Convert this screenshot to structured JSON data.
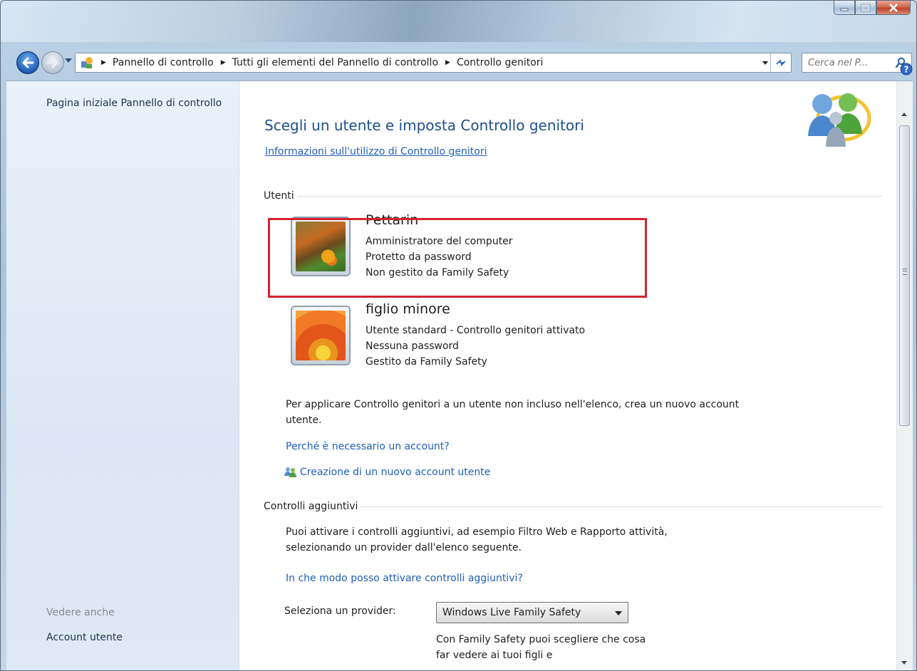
{
  "window": {
    "caption": {
      "minimize": "minimize",
      "maximize": "maximize",
      "close": "close"
    }
  },
  "address_bar": {
    "crumbs": [
      "Pannello di controllo",
      "Tutti gli elementi del Pannello di controllo",
      "Controllo genitori"
    ]
  },
  "search": {
    "placeholder": "Cerca nel P..."
  },
  "sidebar": {
    "home": "Pagina iniziale Pannello di controllo",
    "see_also": "Vedere anche",
    "account_link": "Account utente"
  },
  "main": {
    "title": "Scegli un utente e imposta Controllo genitori",
    "info_link": "Informazioni sull'utilizzo di Controllo genitori",
    "users_section": "Utenti",
    "users": [
      {
        "name": "Pettarin",
        "line1": "Amministratore del computer",
        "line2": "Protetto da password",
        "line3": "Non gestito da Family Safety",
        "picture": "butterfly"
      },
      {
        "name": "figlio minore",
        "line1": "Utente standard - Controllo genitori attivato",
        "line2": "Nessuna password",
        "line3": "Gestito da Family Safety",
        "picture": "orange-flower"
      }
    ],
    "note": "Per applicare Controllo genitori a un utente non incluso nell'elenco, crea un nuovo account utente.",
    "why_link": "Perché è necessario un account?",
    "create_link": "Creazione di un nuovo account utente",
    "additional_section": "Controlli aggiuntivi",
    "additional_text": "Puoi attivare i controlli aggiuntivi, ad esempio Filtro Web e Rapporto attività, selezionando un provider dall'elenco seguente.",
    "how_link": "In che modo posso attivare controlli aggiuntivi?",
    "provider_label": "Seleziona un provider:",
    "provider_selected": "Windows Live Family Safety",
    "provider_desc": "Con Family Safety puoi scegliere che cosa far vedere ai tuoi figli e"
  },
  "colors": {
    "accent_link": "#1f5fb8",
    "title": "#1e4f8c",
    "highlight_border": "#d4232f"
  }
}
